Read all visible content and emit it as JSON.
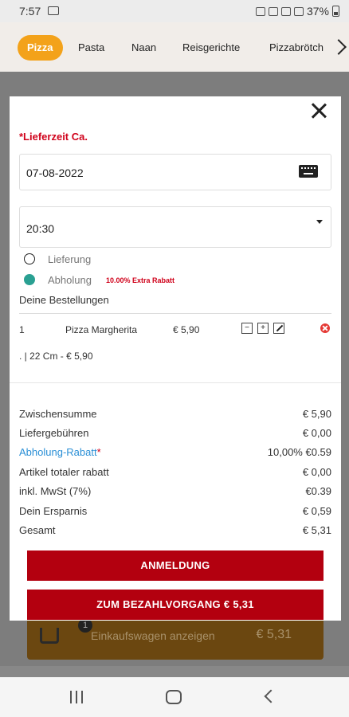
{
  "status_bar": {
    "time": "7:57",
    "battery": "37%"
  },
  "categories": {
    "tabs": [
      {
        "label": "Pizza",
        "active": true
      },
      {
        "label": "Pasta",
        "active": false
      },
      {
        "label": "Naan",
        "active": false
      },
      {
        "label": "Reisgerichte",
        "active": false
      },
      {
        "label": "Pizzabrötch",
        "active": false
      }
    ]
  },
  "modal": {
    "lieferzeit_label": "*Lieferzeit Ca.",
    "date_value": "07-08-2022",
    "time_value": "20:30",
    "delivery_options": [
      {
        "label": "Lieferung",
        "selected": false
      },
      {
        "label": "Abholung",
        "selected": true
      }
    ],
    "abholung_rabatt_note": "10.00% Extra Rabatt",
    "orders_heading": "Deine Bestellungen",
    "items": [
      {
        "qty": "1",
        "name": "Pizza Margherita",
        "price": "€ 5,90",
        "detail": ". | 22 Cm - € 5,90"
      }
    ],
    "item_controls": {
      "minus": "−",
      "plus": "+"
    },
    "summary": [
      {
        "label": "Zwischensumme",
        "value": "€ 5,90"
      },
      {
        "label": "Liefergebühren",
        "value": "€ 0,00"
      },
      {
        "label": "Abholung-Rabatt",
        "star": "*",
        "value": "10,00% €0.59"
      },
      {
        "label": "Artikel totaler rabatt",
        "value": "€ 0,00"
      },
      {
        "label": "inkl. MwSt (7%)",
        "value": "€0.39"
      },
      {
        "label": "Dein Ersparnis",
        "value": "€ 0,59"
      },
      {
        "label": "Gesamt",
        "value": "€ 5,31"
      }
    ],
    "login_button": "ANMELDUNG",
    "checkout_button": "ZUM BEZAHLVORGANG € 5,31"
  },
  "background": {
    "cart_badge": "1",
    "cart_label": "Einkaufswagen anzeigen",
    "cart_total": "€ 5,31"
  },
  "colors": {
    "accent": "#f3a21a",
    "danger": "#b3000f",
    "radio": "#2aa092",
    "link": "#2a8fd6"
  }
}
